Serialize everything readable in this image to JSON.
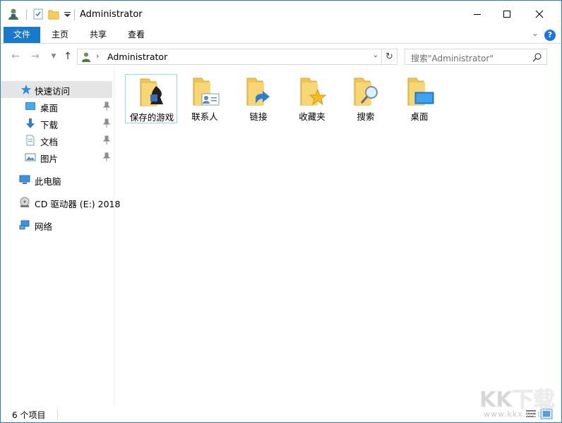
{
  "window": {
    "title": "Administrator"
  },
  "ribbon": {
    "tabs": [
      "文件",
      "主页",
      "共享",
      "查看"
    ],
    "help_label": "?"
  },
  "address": {
    "path": "Administrator",
    "search_placeholder": "搜索\"Administrator\""
  },
  "sidebar": {
    "quick_access": "快速访问",
    "quick_items": [
      "桌面",
      "下载",
      "文档",
      "图片"
    ],
    "this_pc": "此电脑",
    "cd_drive": "CD 驱动器 (E:) 2018",
    "network": "网络"
  },
  "content": {
    "items": [
      "保存的游戏",
      "联系人",
      "链接",
      "收藏夹",
      "搜索",
      "桌面"
    ]
  },
  "status": {
    "item_count": "6 个项目"
  },
  "watermark": {
    "brand": "KK下载",
    "url": "www.kkx.net"
  },
  "colors": {
    "accent": "#1979ca",
    "folder": "#f7cd5e",
    "selection": "#cce8ff",
    "sidebar_selected": "#e5e5e5"
  }
}
